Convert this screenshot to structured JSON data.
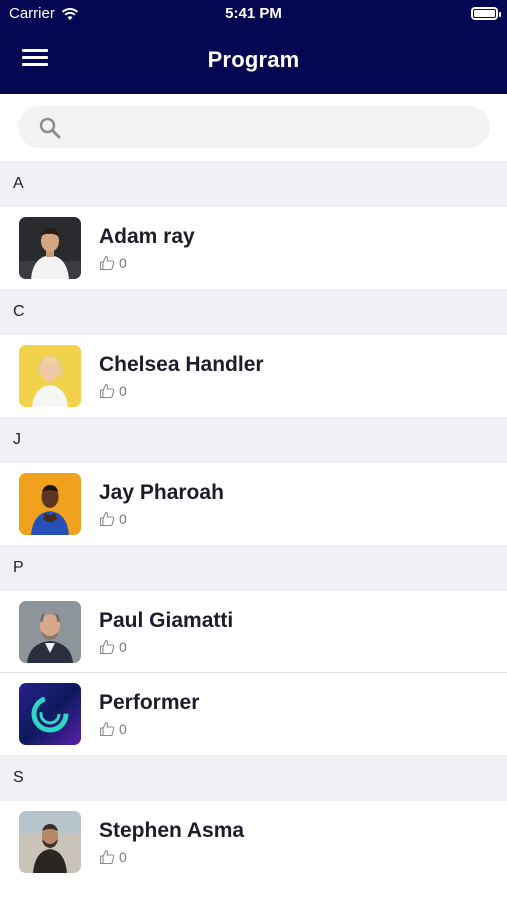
{
  "status": {
    "carrier": "Carrier",
    "time": "5:41 PM"
  },
  "header": {
    "title": "Program"
  },
  "search": {
    "placeholder": ""
  },
  "sections": [
    {
      "letter": "A",
      "items": [
        {
          "name": "Adam ray",
          "likes": "0"
        }
      ]
    },
    {
      "letter": "C",
      "items": [
        {
          "name": "Chelsea Handler",
          "likes": "0"
        }
      ]
    },
    {
      "letter": "J",
      "items": [
        {
          "name": "Jay Pharoah",
          "likes": "0"
        }
      ]
    },
    {
      "letter": "P",
      "items": [
        {
          "name": "Paul Giamatti",
          "likes": "0"
        },
        {
          "name": "Performer",
          "likes": "0"
        }
      ]
    },
    {
      "letter": "S",
      "items": [
        {
          "name": "Stephen Asma",
          "likes": "0"
        }
      ]
    }
  ],
  "colors": {
    "nav_bg": "#050752",
    "section_bg": "#f0f1f4"
  }
}
